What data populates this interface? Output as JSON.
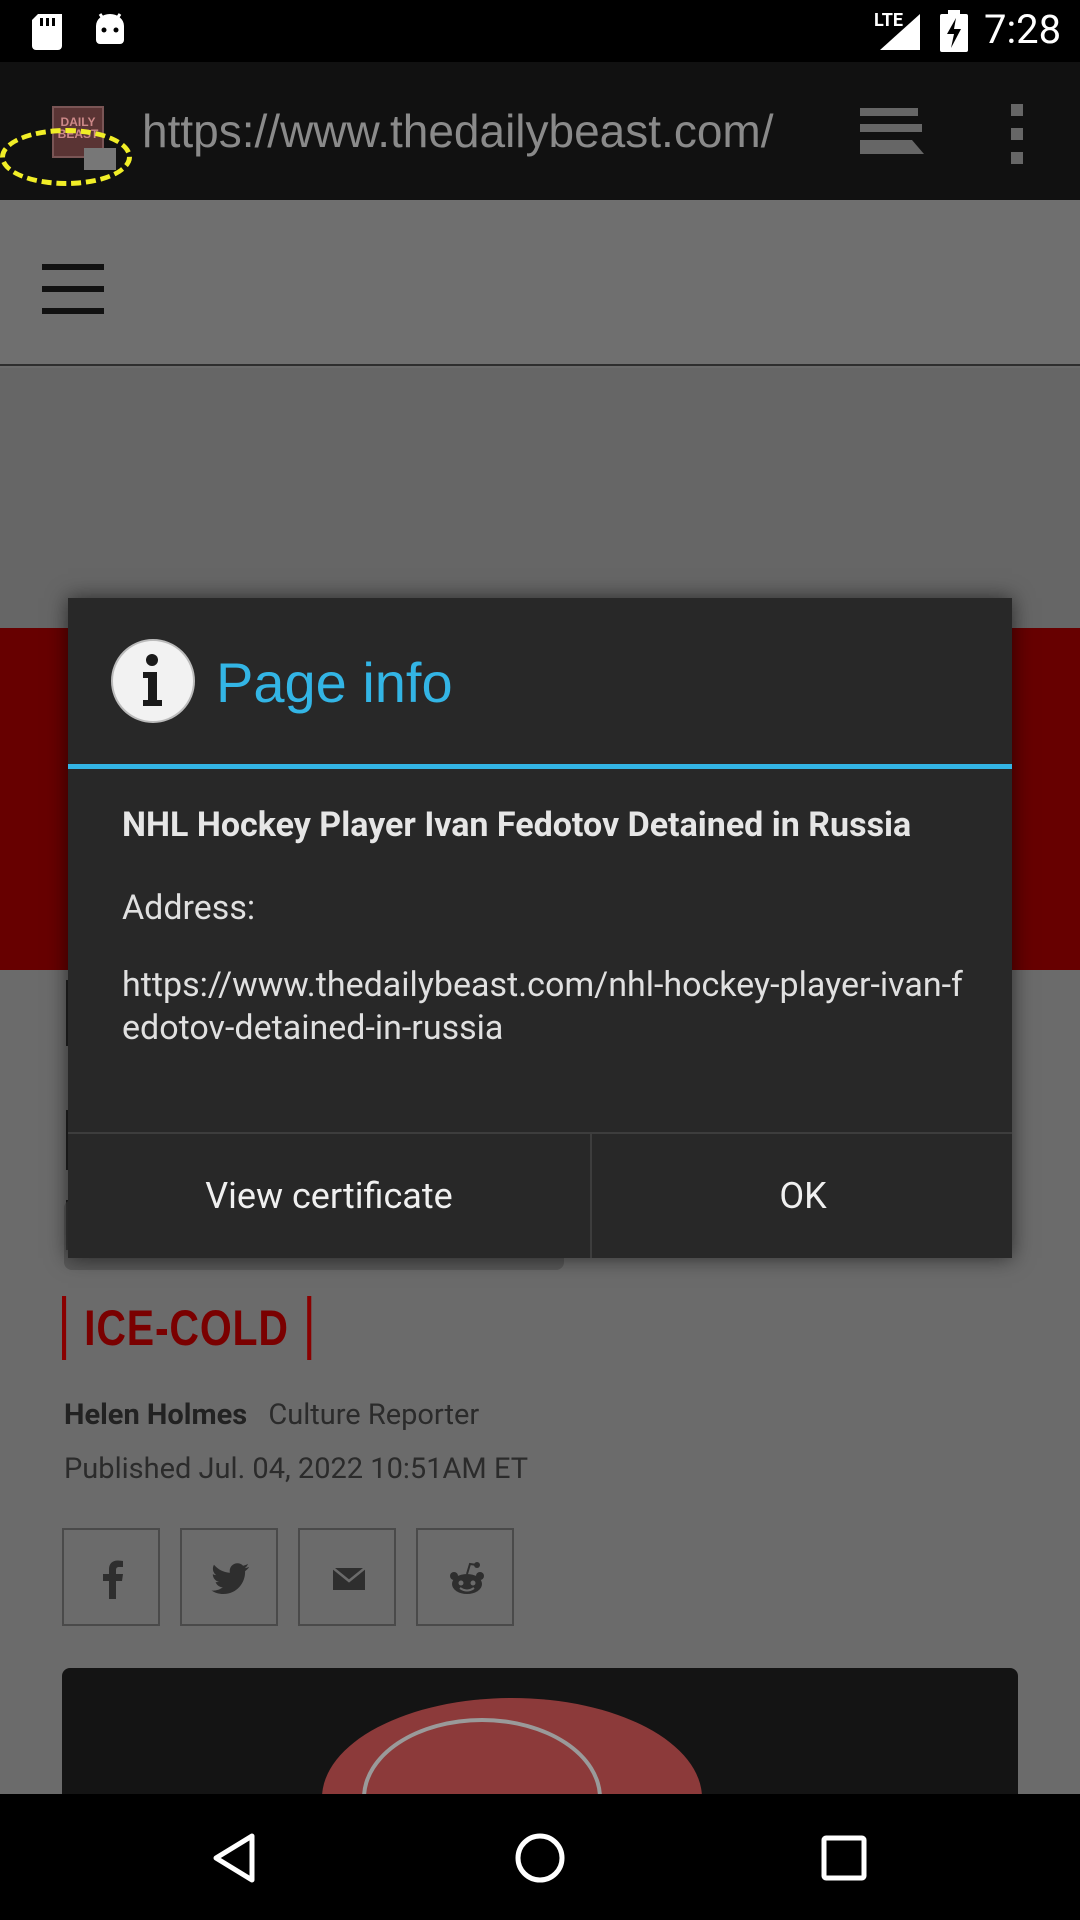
{
  "status_bar": {
    "network": "LTE",
    "time": "7:28"
  },
  "browser": {
    "url": "https://www.thedailybeast.com/",
    "favicon_text": "DAILY BEAST"
  },
  "article": {
    "section_tag": "ICE-COLD",
    "author": "Helen Holmes",
    "author_role": "Culture Reporter",
    "published": "Published Jul. 04, 2022 10:51AM ET",
    "share_icons": [
      "facebook-icon",
      "twitter-icon",
      "mail-icon",
      "reddit-icon"
    ]
  },
  "dialog": {
    "title": "Page info",
    "page_title": "NHL Hockey Player Ivan Fedotov Detained in Russia",
    "address_label": "Address:",
    "address_value": "https://www.thedailybeast.com/nhl-hockey-player-ivan-fedotov-detained-in-russia",
    "buttons": {
      "view_certificate": "View certificate",
      "ok": "OK"
    }
  },
  "colors": {
    "accent": "#33b5e5",
    "dialog_bg": "#282828",
    "banner_red": "#670000",
    "tag_red": "#8a0000",
    "highlight": "#f1ee27"
  }
}
